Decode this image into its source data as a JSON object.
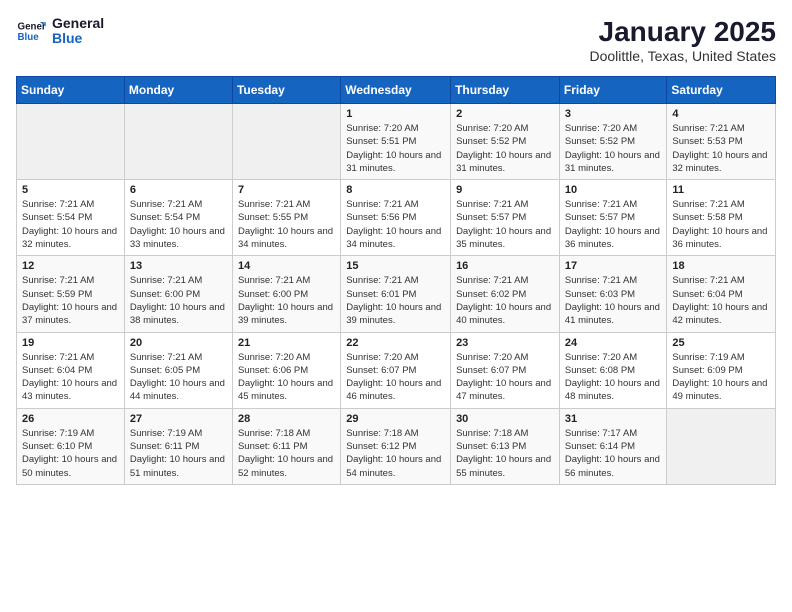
{
  "logo": {
    "line1": "General",
    "line2": "Blue"
  },
  "title": "January 2025",
  "subtitle": "Doolittle, Texas, United States",
  "days_of_week": [
    "Sunday",
    "Monday",
    "Tuesday",
    "Wednesday",
    "Thursday",
    "Friday",
    "Saturday"
  ],
  "weeks": [
    [
      {
        "day": "",
        "sunrise": "",
        "sunset": "",
        "daylight": "",
        "empty": true
      },
      {
        "day": "",
        "sunrise": "",
        "sunset": "",
        "daylight": "",
        "empty": true
      },
      {
        "day": "",
        "sunrise": "",
        "sunset": "",
        "daylight": "",
        "empty": true
      },
      {
        "day": "1",
        "sunrise": "7:20 AM",
        "sunset": "5:51 PM",
        "daylight": "10 hours and 31 minutes."
      },
      {
        "day": "2",
        "sunrise": "7:20 AM",
        "sunset": "5:52 PM",
        "daylight": "10 hours and 31 minutes."
      },
      {
        "day": "3",
        "sunrise": "7:20 AM",
        "sunset": "5:52 PM",
        "daylight": "10 hours and 31 minutes."
      },
      {
        "day": "4",
        "sunrise": "7:21 AM",
        "sunset": "5:53 PM",
        "daylight": "10 hours and 32 minutes."
      }
    ],
    [
      {
        "day": "5",
        "sunrise": "7:21 AM",
        "sunset": "5:54 PM",
        "daylight": "10 hours and 32 minutes."
      },
      {
        "day": "6",
        "sunrise": "7:21 AM",
        "sunset": "5:54 PM",
        "daylight": "10 hours and 33 minutes."
      },
      {
        "day": "7",
        "sunrise": "7:21 AM",
        "sunset": "5:55 PM",
        "daylight": "10 hours and 34 minutes."
      },
      {
        "day": "8",
        "sunrise": "7:21 AM",
        "sunset": "5:56 PM",
        "daylight": "10 hours and 34 minutes."
      },
      {
        "day": "9",
        "sunrise": "7:21 AM",
        "sunset": "5:57 PM",
        "daylight": "10 hours and 35 minutes."
      },
      {
        "day": "10",
        "sunrise": "7:21 AM",
        "sunset": "5:57 PM",
        "daylight": "10 hours and 36 minutes."
      },
      {
        "day": "11",
        "sunrise": "7:21 AM",
        "sunset": "5:58 PM",
        "daylight": "10 hours and 36 minutes."
      }
    ],
    [
      {
        "day": "12",
        "sunrise": "7:21 AM",
        "sunset": "5:59 PM",
        "daylight": "10 hours and 37 minutes."
      },
      {
        "day": "13",
        "sunrise": "7:21 AM",
        "sunset": "6:00 PM",
        "daylight": "10 hours and 38 minutes."
      },
      {
        "day": "14",
        "sunrise": "7:21 AM",
        "sunset": "6:00 PM",
        "daylight": "10 hours and 39 minutes."
      },
      {
        "day": "15",
        "sunrise": "7:21 AM",
        "sunset": "6:01 PM",
        "daylight": "10 hours and 39 minutes."
      },
      {
        "day": "16",
        "sunrise": "7:21 AM",
        "sunset": "6:02 PM",
        "daylight": "10 hours and 40 minutes."
      },
      {
        "day": "17",
        "sunrise": "7:21 AM",
        "sunset": "6:03 PM",
        "daylight": "10 hours and 41 minutes."
      },
      {
        "day": "18",
        "sunrise": "7:21 AM",
        "sunset": "6:04 PM",
        "daylight": "10 hours and 42 minutes."
      }
    ],
    [
      {
        "day": "19",
        "sunrise": "7:21 AM",
        "sunset": "6:04 PM",
        "daylight": "10 hours and 43 minutes."
      },
      {
        "day": "20",
        "sunrise": "7:21 AM",
        "sunset": "6:05 PM",
        "daylight": "10 hours and 44 minutes."
      },
      {
        "day": "21",
        "sunrise": "7:20 AM",
        "sunset": "6:06 PM",
        "daylight": "10 hours and 45 minutes."
      },
      {
        "day": "22",
        "sunrise": "7:20 AM",
        "sunset": "6:07 PM",
        "daylight": "10 hours and 46 minutes."
      },
      {
        "day": "23",
        "sunrise": "7:20 AM",
        "sunset": "6:07 PM",
        "daylight": "10 hours and 47 minutes."
      },
      {
        "day": "24",
        "sunrise": "7:20 AM",
        "sunset": "6:08 PM",
        "daylight": "10 hours and 48 minutes."
      },
      {
        "day": "25",
        "sunrise": "7:19 AM",
        "sunset": "6:09 PM",
        "daylight": "10 hours and 49 minutes."
      }
    ],
    [
      {
        "day": "26",
        "sunrise": "7:19 AM",
        "sunset": "6:10 PM",
        "daylight": "10 hours and 50 minutes."
      },
      {
        "day": "27",
        "sunrise": "7:19 AM",
        "sunset": "6:11 PM",
        "daylight": "10 hours and 51 minutes."
      },
      {
        "day": "28",
        "sunrise": "7:18 AM",
        "sunset": "6:11 PM",
        "daylight": "10 hours and 52 minutes."
      },
      {
        "day": "29",
        "sunrise": "7:18 AM",
        "sunset": "6:12 PM",
        "daylight": "10 hours and 54 minutes."
      },
      {
        "day": "30",
        "sunrise": "7:18 AM",
        "sunset": "6:13 PM",
        "daylight": "10 hours and 55 minutes."
      },
      {
        "day": "31",
        "sunrise": "7:17 AM",
        "sunset": "6:14 PM",
        "daylight": "10 hours and 56 minutes."
      },
      {
        "day": "",
        "sunrise": "",
        "sunset": "",
        "daylight": "",
        "empty": true
      }
    ]
  ],
  "labels": {
    "sunrise": "Sunrise:",
    "sunset": "Sunset:",
    "daylight": "Daylight:"
  }
}
